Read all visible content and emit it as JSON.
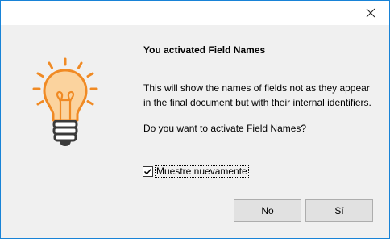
{
  "dialog": {
    "heading": "You activated Field Names",
    "body": "This will show the names of fields not as they appear in the final document but with their internal identifiers.",
    "question": "Do you want to activate Field Names?",
    "checkbox": {
      "label": "Muestre nuevamente",
      "checked": true
    },
    "buttons": {
      "no_label": "No",
      "yes_label": "Sí"
    },
    "icon": "lightbulb-icon"
  },
  "titlebar": {
    "close_icon": "close-icon"
  },
  "colors": {
    "accent_border": "#1883d7",
    "bulb_fill": "#fbd39e",
    "bulb_stroke": "#f08a24",
    "base_stroke": "#3a3a3a"
  }
}
